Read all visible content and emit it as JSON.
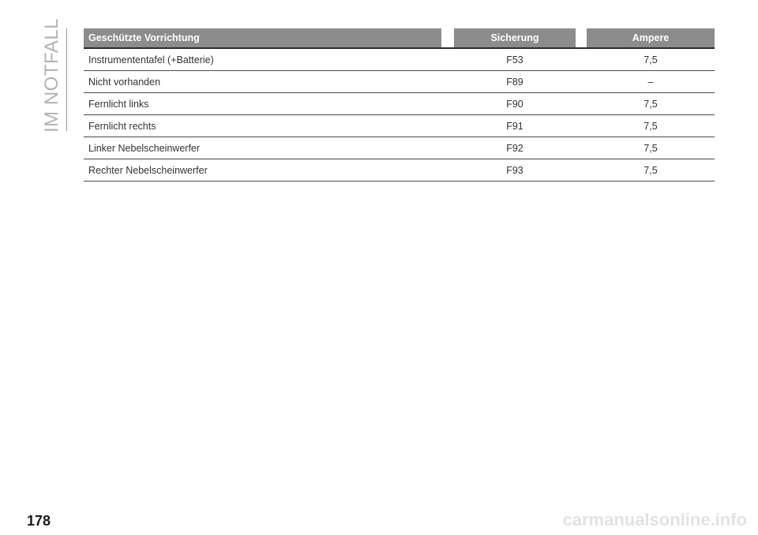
{
  "section_label": "IM NOTFALL",
  "table": {
    "headers": {
      "device": "Geschützte Vorrichtung",
      "fuse": "Sicherung",
      "ampere": "Ampere"
    },
    "rows": [
      {
        "device": "Instrumententafel (+Batterie)",
        "fuse": "F53",
        "ampere": "7,5"
      },
      {
        "device": "Nicht vorhanden",
        "fuse": "F89",
        "ampere": "–"
      },
      {
        "device": "Fernlicht links",
        "fuse": "F90",
        "ampere": "7,5"
      },
      {
        "device": "Fernlicht rechts",
        "fuse": "F91",
        "ampere": "7,5"
      },
      {
        "device": "Linker Nebelscheinwerfer",
        "fuse": "F92",
        "ampere": "7,5"
      },
      {
        "device": "Rechter Nebelscheinwerfer",
        "fuse": "F93",
        "ampere": "7,5"
      }
    ]
  },
  "page_number": "178",
  "watermark": "carmanualsonline.info"
}
